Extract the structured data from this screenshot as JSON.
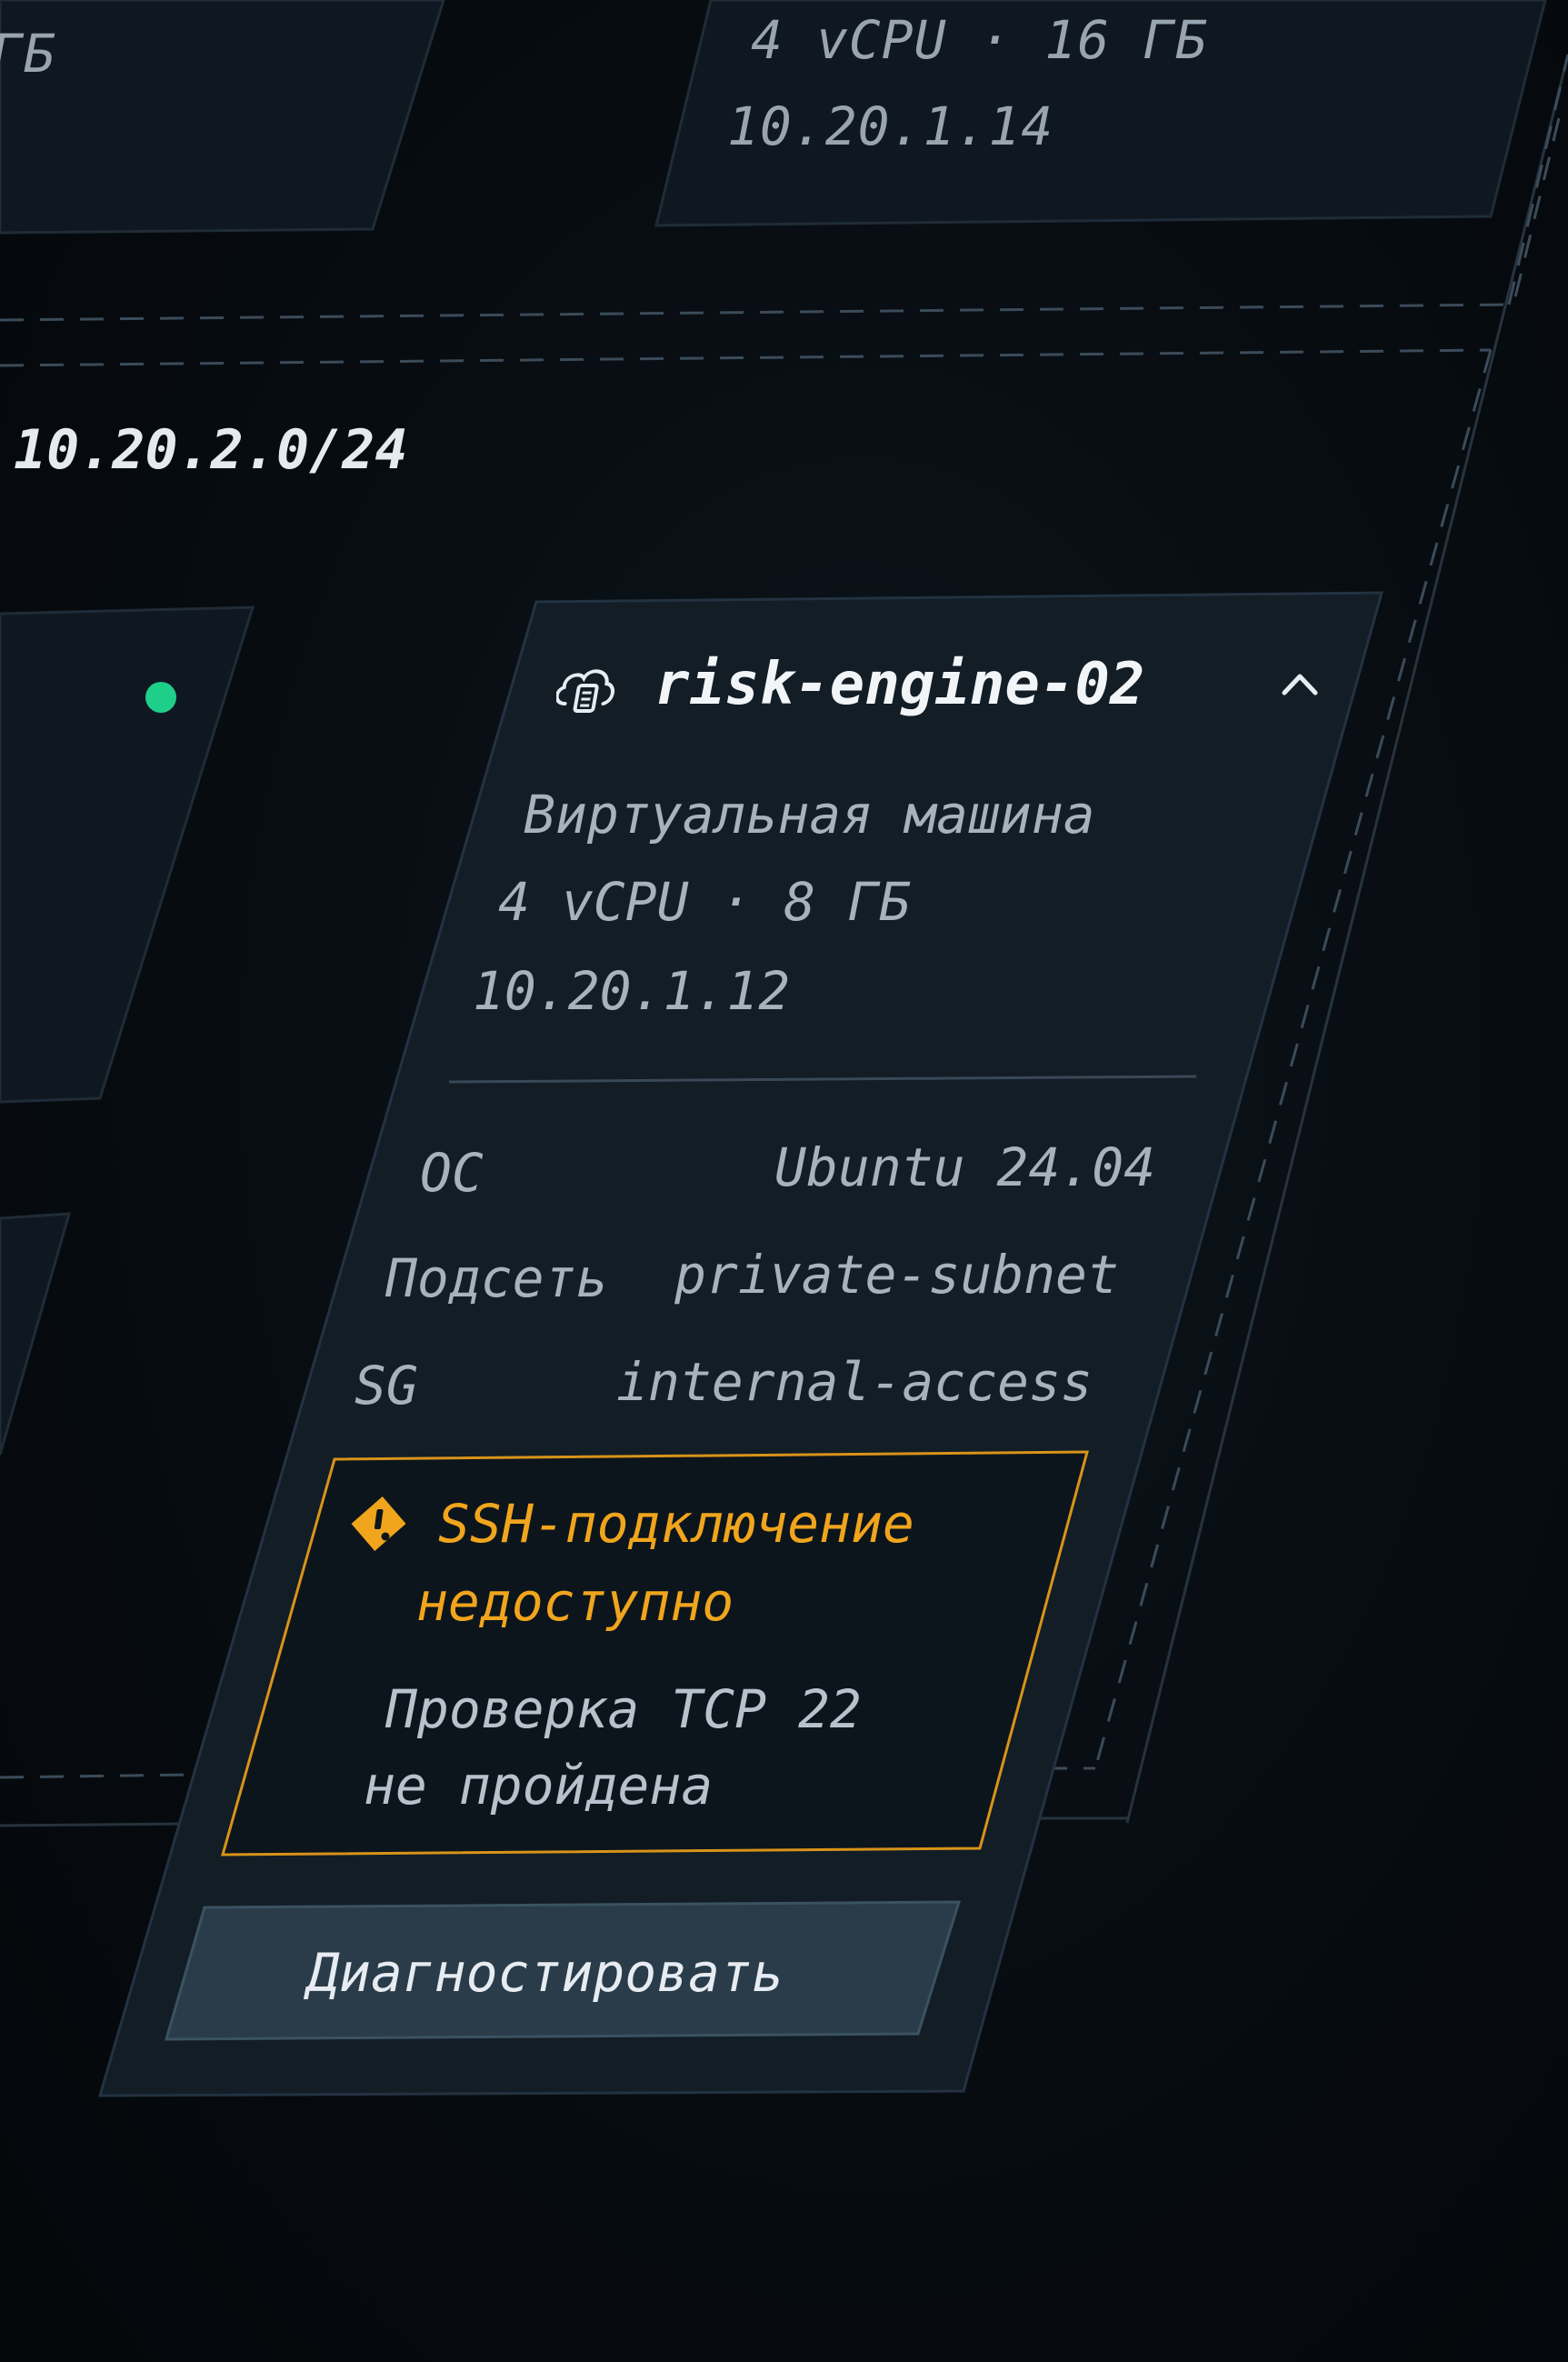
{
  "top_cards": {
    "left_partial_text": "ГБ",
    "right_specs": "4 vCPU · 16 ГБ",
    "right_ip": "10.20.1.14"
  },
  "subnet": {
    "cidr": "10.20.2.0/24"
  },
  "status": {
    "online_color": "#1ecf8a"
  },
  "vm_card": {
    "name": "risk-engine-02",
    "icon": "cloud-server-icon",
    "collapse_icon": "chevron-up-icon",
    "type": "Виртуальная машина",
    "specs": "4 vCPU · 8 ГБ",
    "ip": "10.20.1.12",
    "details": [
      {
        "label": "ОС",
        "value": "Ubuntu 24.04"
      },
      {
        "label": "Подсеть",
        "value": "private-subnet"
      },
      {
        "label": "SG",
        "value": "internal-access"
      }
    ],
    "alert": {
      "icon": "warning-icon",
      "title_line1": "SSH-подключение",
      "title_line2": "недоступно",
      "desc_line1": "Проверка TCP 22",
      "desc_line2": "не пройдена",
      "color": "#f0a51d"
    },
    "action_label": "Диагностировать"
  }
}
